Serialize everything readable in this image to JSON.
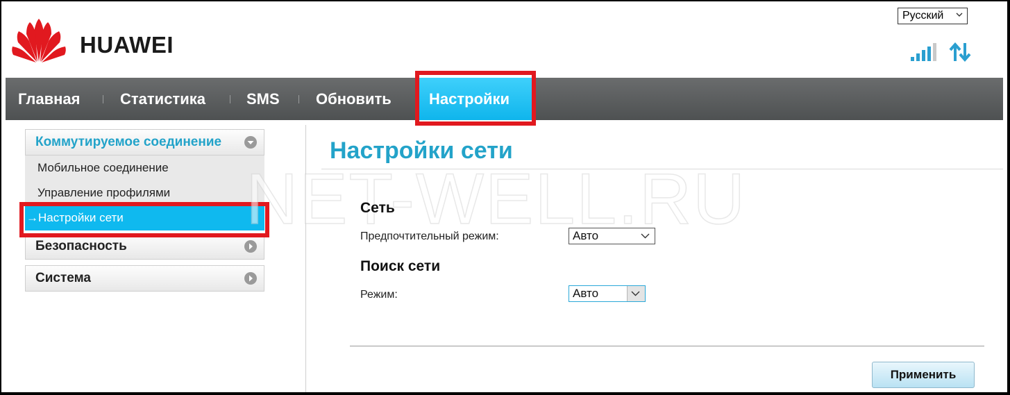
{
  "brand": "HUAWEI",
  "language": "Русский",
  "nav": {
    "items": [
      "Главная",
      "Статистика",
      "SMS",
      "Обновить",
      "Настройки"
    ],
    "active": "Настройки"
  },
  "sidebar": {
    "dialup": {
      "label": "Коммутируемое соединение",
      "items": [
        "Мобильное соединение",
        "Управление профилями",
        "Настройки сети"
      ],
      "active_prefix": "→"
    },
    "security": "Безопасность",
    "system": "Система"
  },
  "content": {
    "title": "Настройки сети",
    "network_section": "Сеть",
    "preferred_mode_label": "Предпочтительный режим:",
    "preferred_mode_value": "Авто",
    "search_section": "Поиск сети",
    "mode_label": "Режим:",
    "mode_value": "Авто",
    "apply_button": "Применить"
  },
  "watermark": "NET-WELL.RU",
  "colors": {
    "accent": "#23a3c9",
    "nav_active": "#1cbdf0",
    "highlight_box": "#e1191f",
    "nav_bar": "#595c5d"
  },
  "icons": [
    "huawei-logo-icon",
    "signal-strength-icon",
    "data-transfer-icon",
    "chevron-down-icon",
    "circle-down-icon",
    "circle-right-icon"
  ]
}
